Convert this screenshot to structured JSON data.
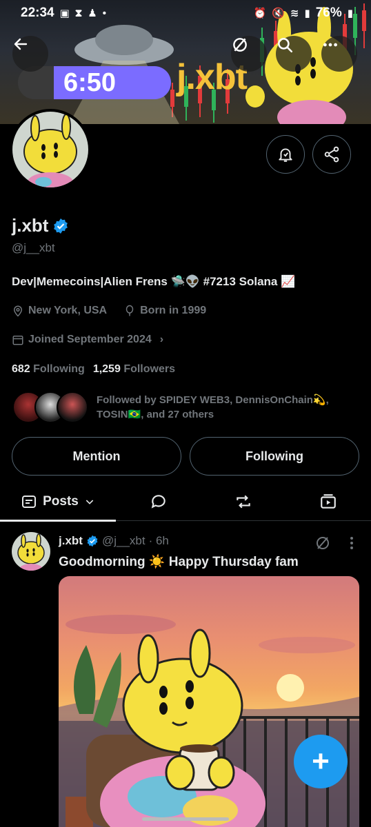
{
  "status_bar": {
    "time": "22:34",
    "battery": "76%"
  },
  "banner": {
    "title_text": "j.xbt",
    "timer": "6:50"
  },
  "profile": {
    "name": "j.xbt",
    "handle": "@j__xbt",
    "bio": "Dev|Memecoins|Alien Frens 🛸👽 #7213  Solana 📈",
    "location": "New York, USA",
    "birth": "Born in 1999",
    "joined": "Joined September 2024",
    "following_count": "682",
    "following_label": "Following",
    "followers_count": "1,259",
    "followers_label": "Followers",
    "followed_by": "Followed by SPIDEY WEB3, DennisOnChain💫, TOSIN🇧🇷, and 27 others"
  },
  "actions": {
    "mention": "Mention",
    "following": "Following"
  },
  "tabs": {
    "posts": "Posts"
  },
  "post": {
    "name": "j.xbt",
    "handle": "@j__xbt",
    "time": "· 6h",
    "text": "Goodmorning ☀️ Happy Thursday fam"
  },
  "colors": {
    "accent": "#1d9bf0",
    "background": "#000000",
    "secondary_text": "#71767b"
  }
}
